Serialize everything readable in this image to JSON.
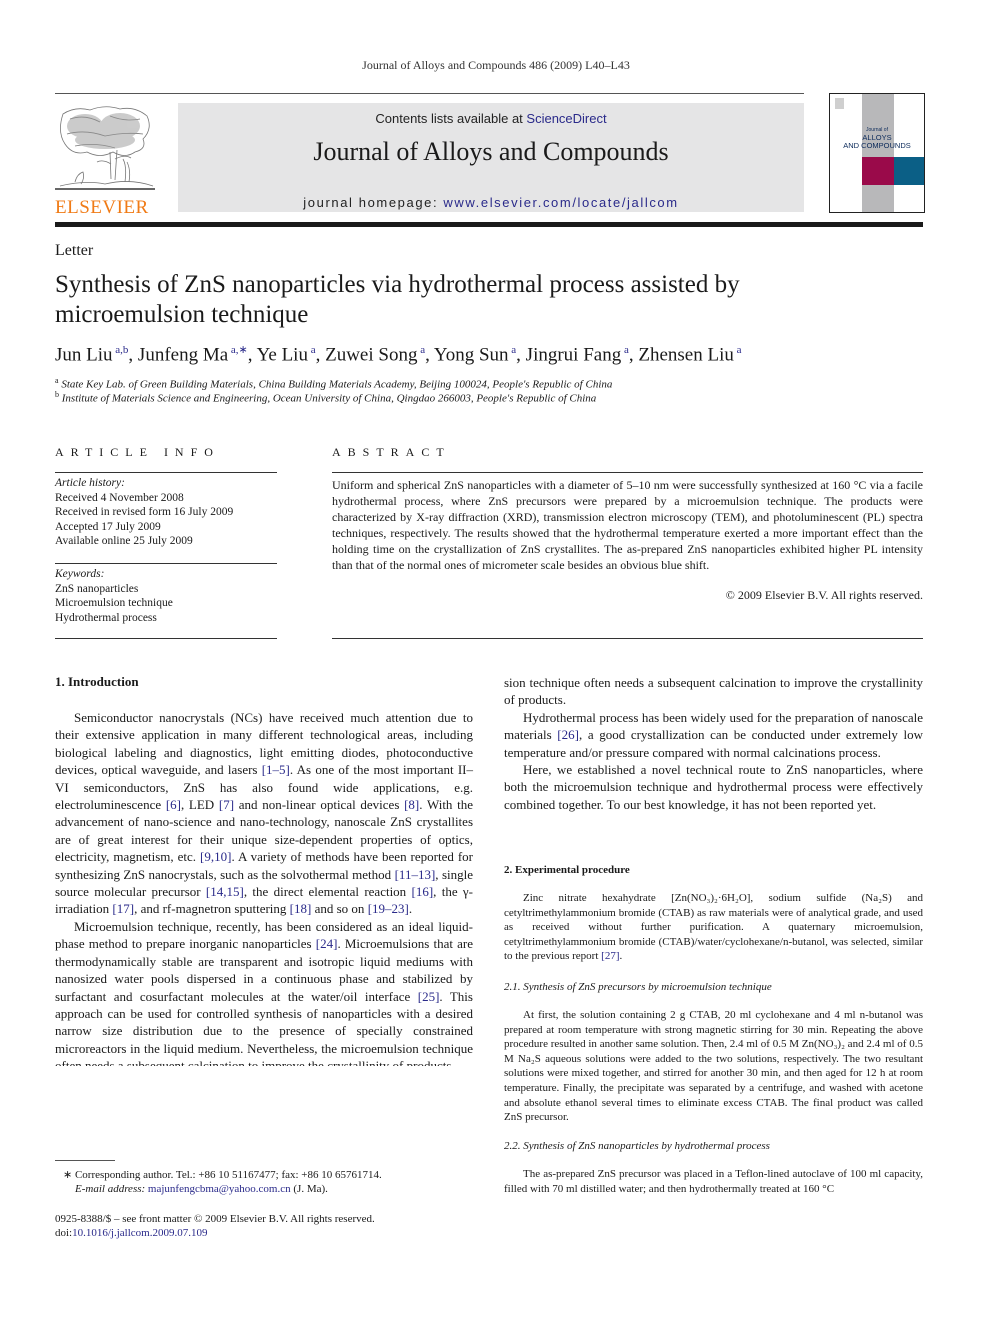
{
  "running_head": "Journal of Alloys and Compounds 486 (2009) L40–L43",
  "header": {
    "contents_prefix": "Contents lists available at ",
    "contents_link": "ScienceDirect",
    "journal_title": "Journal of Alloys and Compounds",
    "homepage_prefix": "journal homepage: ",
    "homepage_link": "www.elsevier.com/locate/jallcom",
    "publisher_logo_text": "ELSEVIER",
    "cover": {
      "line1": "Journal of",
      "line2": "ALLOYS",
      "line3": "AND COMPOUNDS",
      "colors": {
        "grey": "#b8b8ba",
        "magenta": "#9a0a4a",
        "teal": "#0b5f86"
      }
    },
    "logo_color": "#f07b16"
  },
  "article": {
    "type": "Letter",
    "title_line1": "Synthesis of ZnS nanoparticles via hydrothermal process assisted by",
    "title_line2": "microemulsion technique",
    "authors": [
      {
        "name": "Jun Liu",
        "sup": "a,b",
        "sep": ", "
      },
      {
        "name": "Junfeng Ma",
        "sup": "a,∗",
        "sep": ", "
      },
      {
        "name": "Ye Liu",
        "sup": "a",
        "sep": ", "
      },
      {
        "name": "Zuwei Song",
        "sup": "a",
        "sep": ", "
      },
      {
        "name": "Yong Sun",
        "sup": "a",
        "sep": ", "
      },
      {
        "name": "Jingrui Fang",
        "sup": "a",
        "sep": ", "
      },
      {
        "name": "Zhensen Liu",
        "sup": "a",
        "sep": ""
      }
    ],
    "affiliations": [
      {
        "sup": "a",
        "text": "State Key Lab. of Green Building Materials, China Building Materials Academy, Beijing 100024, People's Republic of China"
      },
      {
        "sup": "b",
        "text": "Institute of Materials Science and Engineering, Ocean University of China, Qingdao 266003, People's Republic of China"
      }
    ]
  },
  "article_info": {
    "heading": "ARTICLE INFO",
    "history_label": "Article history:",
    "history": [
      "Received 4 November 2008",
      "Received in revised form 16 July 2009",
      "Accepted 17 July 2009",
      "Available online 25 July 2009"
    ],
    "keywords_label": "Keywords:",
    "keywords": [
      "ZnS nanoparticles",
      "Microemulsion technique",
      "Hydrothermal process"
    ]
  },
  "abstract": {
    "heading": "ABSTRACT",
    "text": "Uniform and spherical ZnS nanoparticles with a diameter of 5–10 nm were successfully synthesized at 160 °C via a facile hydrothermal process, where ZnS precursors were prepared by a microemulsion technique. The products were characterized by X-ray diffraction (XRD), transmission electron microscopy (TEM), and photoluminescent (PL) spectra techniques, respectively. The results showed that the hydrothermal temperature exerted a more important effect than the holding time on the crystallization of ZnS crystallites. The as-prepared ZnS nanoparticles exhibited higher PL intensity than that of the normal ones of micrometer scale besides an obvious blue shift.",
    "copyright": "© 2009 Elsevier B.V. All rights reserved."
  },
  "body": {
    "sec1_heading": "1.  Introduction",
    "p1": [
      {
        "t": "Semiconductor nanocrystals (NCs) have received much attention due to their extensive application in many different technological areas, including biological labeling and diagnostics, light emitting diodes, photoconductive devices, optical waveguide, and lasers "
      },
      {
        "r": "[1–5]"
      },
      {
        "t": ". As one of the most important II–VI semiconductors, ZnS has also found wide applications, e.g. electroluminescence "
      },
      {
        "r": "[6]"
      },
      {
        "t": ", LED "
      },
      {
        "r": "[7]"
      },
      {
        "t": " and non-linear optical devices "
      },
      {
        "r": "[8]"
      },
      {
        "t": ". With the advancement of nano-science and nano-technology, nanoscale ZnS crystallites are of great interest for their unique size-dependent properties of optics, electricity, magnetism, etc. "
      },
      {
        "r": "[9,10]"
      },
      {
        "t": ". A variety of methods have been reported for synthesizing ZnS nanocrystals, such as the solvothermal method "
      },
      {
        "r": "[11–13]"
      },
      {
        "t": ", single source molecular precursor "
      },
      {
        "r": "[14,15]"
      },
      {
        "t": ", the direct elemental reaction "
      },
      {
        "r": "[16]"
      },
      {
        "t": ", the γ-irradiation "
      },
      {
        "r": "[17]"
      },
      {
        "t": ", and rf-magnetron sputtering "
      },
      {
        "r": "[18]"
      },
      {
        "t": " and so on "
      },
      {
        "r": "[19–23]"
      },
      {
        "t": "."
      }
    ],
    "p2": [
      {
        "t": "Microemulsion technique, recently, has been considered as an ideal liquid-phase method to prepare inorganic nanoparticles "
      },
      {
        "r": "[24]"
      },
      {
        "t": ". Microemulsions that are thermodynamically stable are transparent and isotropic liquid mediums with nanosized water pools dispersed in a continuous phase and stabilized by surfactant and cosurfactant molecules at the water/oil interface "
      },
      {
        "r": "[25]"
      },
      {
        "t": ". This approach can be used for controlled synthesis of nanoparticles with a desired narrow size distribution due to the presence of specially constrained microreactors in the liquid medium. Nevertheless, the microemulsion technique often needs a subsequent calcination to improve the crystallinity of products."
      }
    ],
    "p3": [
      {
        "t": "Hydrothermal process has been widely used for the preparation of nanoscale materials "
      },
      {
        "r": "[26]"
      },
      {
        "t": ", a good crystallization can be conducted under extremely low temperature and/or pressure compared with normal calcinations process."
      }
    ],
    "p4": [
      {
        "t": "Here, we established a novel technical route to ZnS nanoparticles, where both the microemulsion technique and hydrothermal process were effectively combined together. To our best knowledge, it has not been reported yet."
      }
    ],
    "sec2_heading": "2.  Experimental procedure",
    "p5": [
      {
        "t": "Zinc nitrate hexahydrate [Zn(NO₃)₂·6H₂O], sodium sulfide (Na₂S) and cetyltrimethylammonium bromide (CTAB) as raw materials were of analytical grade, and used as received without further purification. A quaternary microemulsion, cetyltrimethylammonium bromide (CTAB)/water/cyclohexane/n-butanol, was selected, similar to the previous report "
      },
      {
        "r": "[27]"
      },
      {
        "t": "."
      }
    ],
    "sec21_heading": "2.1.   Synthesis of ZnS precursors by microemulsion technique",
    "p6": [
      {
        "t": "At first, the solution containing 2 g CTAB, 20 ml cyclohexane and 4 ml n-butanol was prepared at room temperature with strong magnetic stirring for 30 min. Repeating the above procedure resulted in another same solution. Then, 2.4 ml of 0.5 M Zn(NO₃)₂ and 2.4 ml of 0.5 M Na₂S aqueous solutions were added to the two solutions, respectively. The two resultant solutions were mixed together, and stirred for another 30 min, and then aged for 12 h at room temperature. Finally, the precipitate was separated by a centrifuge, and washed with acetone and absolute ethanol several times to eliminate excess CTAB. The final product was called ZnS precursor."
      }
    ],
    "sec22_heading": "2.2.   Synthesis of ZnS nanoparticles by hydrothermal process",
    "p7": [
      {
        "t": "The as-prepared ZnS precursor was placed in a Teflon-lined autoclave of 100 ml capacity, filled with 70 ml distilled water; and then hydrothermally treated at 160 °C"
      }
    ]
  },
  "footnotes": {
    "corresponding": "∗   Corresponding author. Tel.: +86 10 51167477; fax: +86 10 65761714.",
    "email_label": "E-mail address: ",
    "email": "majunfengcbma@yahoo.com.cn",
    "email_suffix": " (J. Ma).",
    "issn": "0925-8388/$ – see front matter © 2009 Elsevier B.V. All rights reserved.",
    "doi_label": "doi:",
    "doi": "10.1016/j.jallcom.2009.07.109"
  }
}
